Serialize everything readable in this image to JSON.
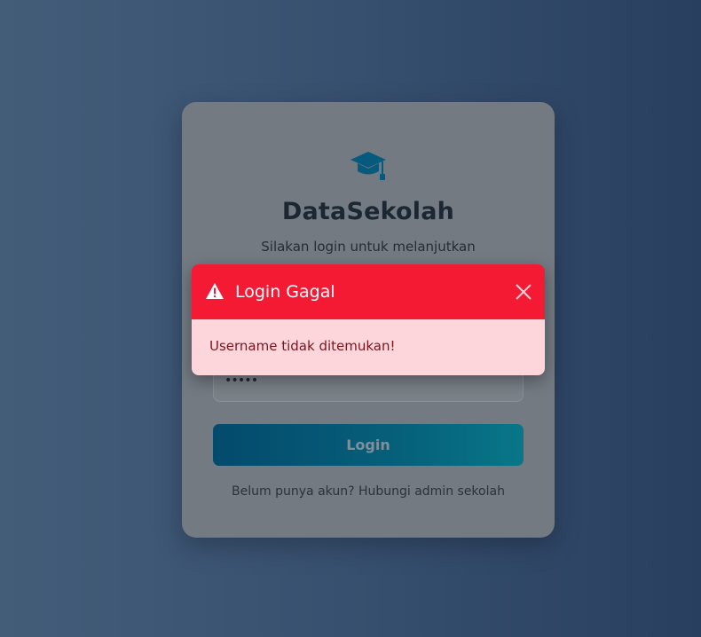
{
  "app": {
    "name": "DataSekolah",
    "subtitle": "Silakan login untuk melanjutkan",
    "logo_icon": "graduation-cap-icon"
  },
  "form": {
    "password_value": "•••••",
    "login_label": "Login",
    "footer_text": "Belum punya akun? Hubungi admin sekolah"
  },
  "alert": {
    "title": "Login Gagal",
    "message": "Username tidak ditemukan!",
    "icon": "warning-icon",
    "close_icon": "close-icon",
    "header_color": "#f41a34",
    "body_color": "#fdd6db"
  },
  "colors": {
    "accent": "#066079",
    "card": "#737a82"
  }
}
